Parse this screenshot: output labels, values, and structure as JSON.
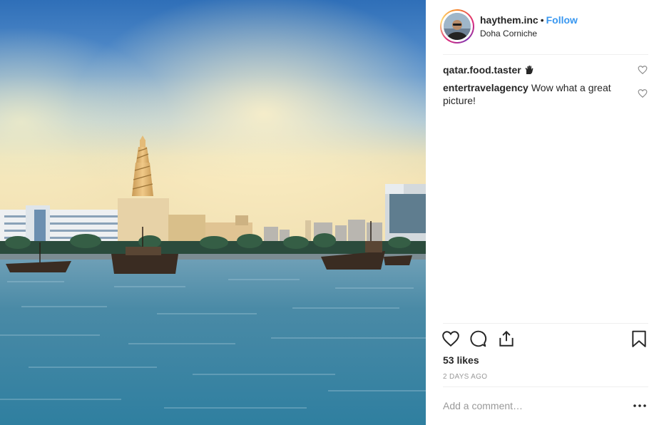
{
  "photo": {
    "location": "Doha Corniche",
    "scene": "harbor-with-spiral-minaret"
  },
  "header": {
    "username": "haythem.inc",
    "separator": "•",
    "follow_label": "Follow",
    "location": "Doha Corniche"
  },
  "comments": [
    {
      "author": "qatar.food.taster",
      "text": "",
      "emoji_icon": "raised-hand-icon"
    },
    {
      "author": "entertravelagency",
      "text": "Wow what a great picture!"
    }
  ],
  "actions": {
    "like_icon": "heart-icon",
    "comment_icon": "comment-bubble-icon",
    "share_icon": "share-icon",
    "save_icon": "bookmark-icon"
  },
  "likes_text": "53 likes",
  "timestamp": "2 DAYS AGO",
  "add_comment": {
    "placeholder": "Add a comment…",
    "more_icon": "more-options-icon"
  },
  "colors": {
    "follow": "#3897f0",
    "text": "#262626",
    "muted": "#999999",
    "divider": "#efefef"
  }
}
